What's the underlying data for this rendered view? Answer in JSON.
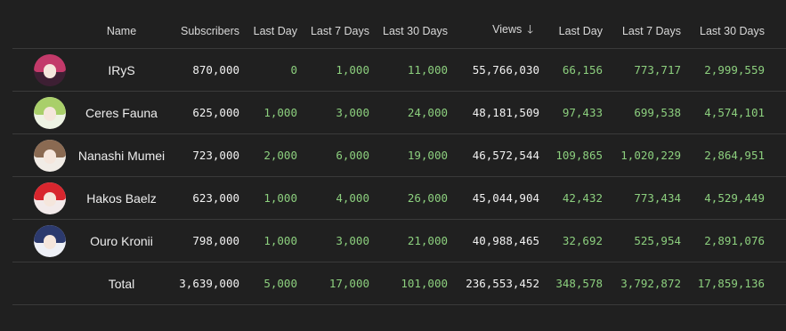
{
  "headers": {
    "name": "Name",
    "subscribers": "Subscribers",
    "sub_last_day": "Last Day",
    "sub_last_7": "Last 7 Days",
    "sub_last_30": "Last 30 Days",
    "views": "Views",
    "views_last_day": "Last Day",
    "views_last_7": "Last 7 Days",
    "views_last_30": "Last 30 Days",
    "sort_icon": "arrow-down-icon"
  },
  "rows": [
    {
      "name": "IRyS",
      "subscribers": "870,000",
      "sub_day": "0",
      "sub_7": "1,000",
      "sub_30": "11,000",
      "views": "55,766,030",
      "v_day": "66,156",
      "v_7": "773,717",
      "v_30": "2,999,559",
      "avatar_colors": [
        "#3d1f33",
        "#c33a6a"
      ]
    },
    {
      "name": "Ceres Fauna",
      "subscribers": "625,000",
      "sub_day": "1,000",
      "sub_7": "3,000",
      "sub_30": "24,000",
      "views": "48,181,509",
      "v_day": "97,433",
      "v_7": "699,538",
      "v_30": "4,574,101",
      "avatar_colors": [
        "#eef3e4",
        "#a9cf6a"
      ]
    },
    {
      "name": "Nanashi Mumei",
      "subscribers": "723,000",
      "sub_day": "2,000",
      "sub_7": "6,000",
      "sub_30": "19,000",
      "views": "46,572,544",
      "v_day": "109,865",
      "v_7": "1,020,229",
      "v_30": "2,864,951",
      "avatar_colors": [
        "#f1ece6",
        "#8a6a52"
      ]
    },
    {
      "name": "Hakos Baelz",
      "subscribers": "623,000",
      "sub_day": "1,000",
      "sub_7": "4,000",
      "sub_30": "26,000",
      "views": "45,044,904",
      "v_day": "42,432",
      "v_7": "773,434",
      "v_30": "4,529,449",
      "avatar_colors": [
        "#f2eaea",
        "#d8262e"
      ]
    },
    {
      "name": "Ouro Kronii",
      "subscribers": "798,000",
      "sub_day": "1,000",
      "sub_7": "3,000",
      "sub_30": "21,000",
      "views": "40,988,465",
      "v_day": "32,692",
      "v_7": "525,954",
      "v_30": "2,891,076",
      "avatar_colors": [
        "#eef0f6",
        "#2c3a6e"
      ]
    }
  ],
  "total": {
    "name": "Total",
    "subscribers": "3,639,000",
    "sub_day": "5,000",
    "sub_7": "17,000",
    "sub_30": "101,000",
    "views": "236,553,452",
    "v_day": "348,578",
    "v_7": "3,792,872",
    "v_30": "17,859,136"
  }
}
